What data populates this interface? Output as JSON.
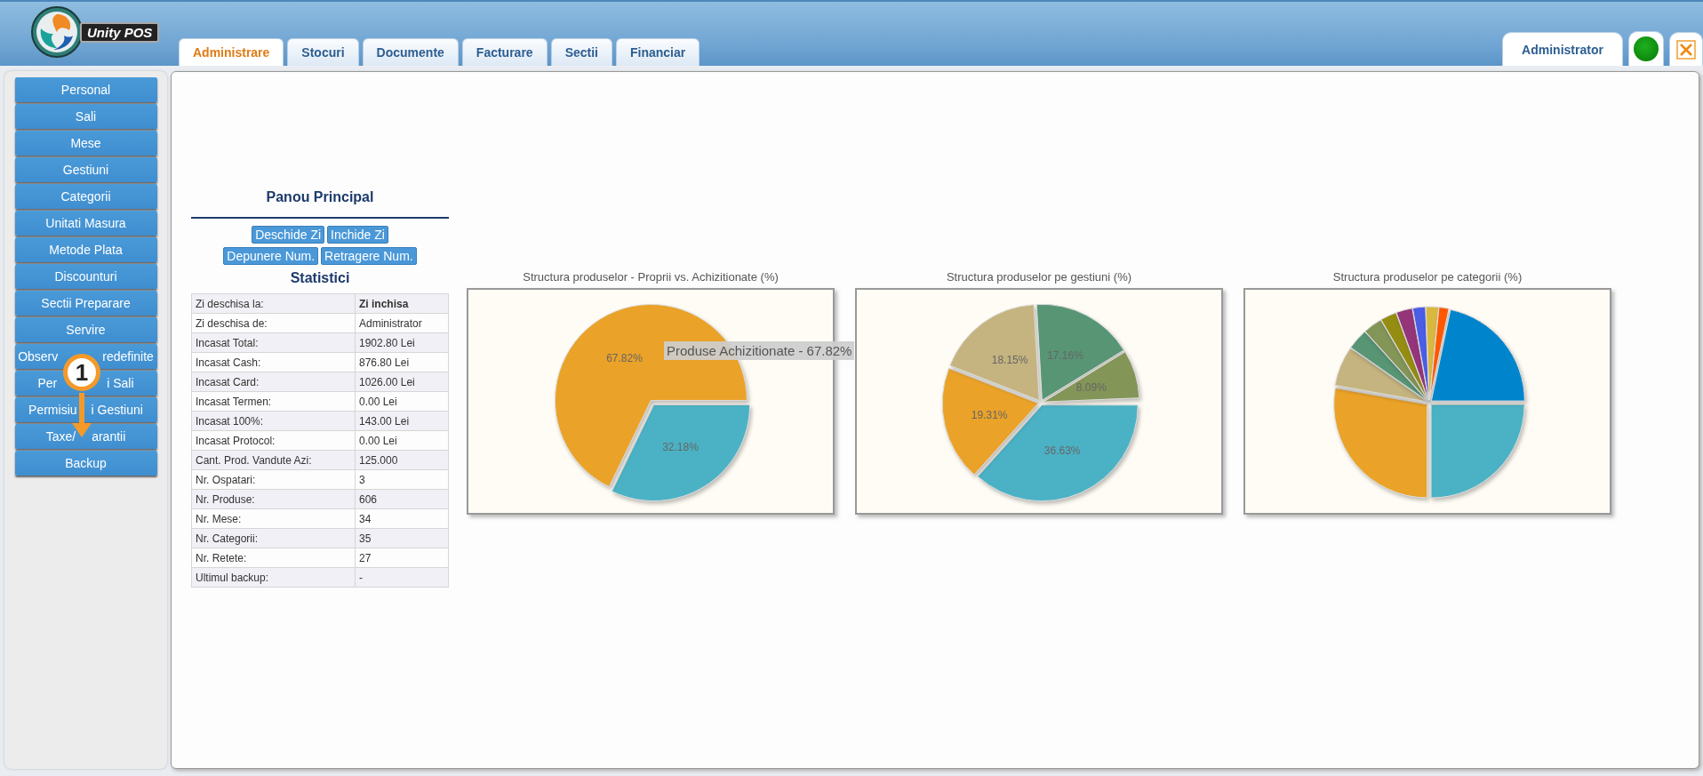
{
  "header": {
    "logo_text": "Unity POS",
    "tabs": [
      {
        "label": "Administrare",
        "selected": true
      },
      {
        "label": "Stocuri",
        "selected": false
      },
      {
        "label": "Documente",
        "selected": false
      },
      {
        "label": "Facturare",
        "selected": false
      },
      {
        "label": "Sectii",
        "selected": false
      },
      {
        "label": "Financiar",
        "selected": false
      }
    ],
    "user": "Administrator",
    "online": true
  },
  "sidebar": {
    "items": [
      {
        "label": "Personal"
      },
      {
        "label": "Sali"
      },
      {
        "label": "Mese"
      },
      {
        "label": "Gestiuni"
      },
      {
        "label": "Categorii"
      },
      {
        "label": "Unitati Masura"
      },
      {
        "label": "Metode Plata"
      },
      {
        "label": "Discounturi"
      },
      {
        "label": "Sectii Preparare"
      },
      {
        "label": "Servire"
      },
      {
        "label_parts": [
          "Observ",
          "redefinite"
        ]
      },
      {
        "label_parts": [
          "Per",
          "i Sali"
        ]
      },
      {
        "label_parts": [
          "Permisiu",
          "i Gestiuni"
        ]
      },
      {
        "label_parts": [
          "Taxe/",
          "arantii"
        ]
      },
      {
        "label": "Backup"
      }
    ]
  },
  "step_marker": {
    "label": "1"
  },
  "panel": {
    "title": "Panou Principal",
    "button_rows": [
      [
        "Deschide Zi",
        "Inchide Zi"
      ],
      [
        "Depunere Num.",
        "Retragere Num."
      ]
    ],
    "stats_title": "Statistici",
    "stats": [
      {
        "label": "Zi deschisa la:",
        "value": "Zi inchisa",
        "bold": true
      },
      {
        "label": "Zi deschisa de:",
        "value": "Administrator",
        "bold": false
      },
      {
        "label": "Incasat Total:",
        "value": "1902.80 Lei",
        "bold": false
      },
      {
        "label": "Incasat Cash:",
        "value": "876.80 Lei",
        "bold": false
      },
      {
        "label": "Incasat Card:",
        "value": "1026.00 Lei",
        "bold": false
      },
      {
        "label": "Incasat Termen:",
        "value": "0.00 Lei",
        "bold": false
      },
      {
        "label": "Incasat 100%:",
        "value": "143.00 Lei",
        "bold": false
      },
      {
        "label": "Incasat Protocol:",
        "value": "0.00 Lei",
        "bold": false
      },
      {
        "label": "Cant. Prod. Vandute Azi:",
        "value": "125.000",
        "bold": false
      },
      {
        "label": "Nr. Ospatari:",
        "value": "3",
        "bold": false
      },
      {
        "label": "Nr. Produse:",
        "value": "606",
        "bold": false
      },
      {
        "label": "Nr. Mese:",
        "value": "34",
        "bold": false
      },
      {
        "label": "Nr. Categorii:",
        "value": "35",
        "bold": false
      },
      {
        "label": "Nr. Retete:",
        "value": "27",
        "bold": false
      },
      {
        "label": "Ultimul backup:",
        "value": "-",
        "bold": false
      }
    ]
  },
  "charts": [
    {
      "chart_data": {
        "type": "pie",
        "title": "Structura produselor - Proprii vs. Achizitionate (%)",
        "values": [
          32.18,
          67.82
        ],
        "value_labels": [
          "32.18%",
          "67.82%"
        ],
        "annotations": [
          "Produse Achizitionate - 67.82%"
        ]
      }
    },
    {
      "chart_data": {
        "type": "pie",
        "title": "Structura produselor pe gestiuni (%)",
        "values": [
          36.63,
          19.31,
          18.15,
          17.16,
          8.09
        ],
        "value_labels": [
          "36.63%",
          "19.31%",
          "18.15%",
          "17.16%",
          "8.09%"
        ]
      }
    },
    {
      "title": "Structura produselor pe categorii (%)",
      "kind": "picture"
    }
  ]
}
